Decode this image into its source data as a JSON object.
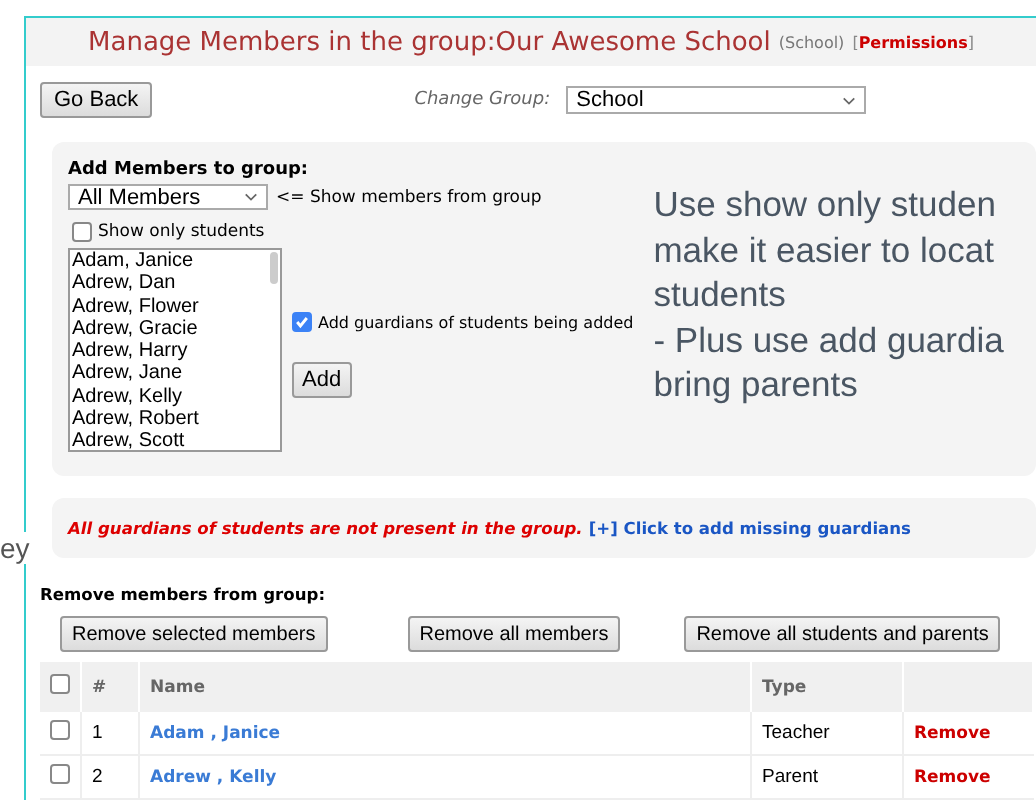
{
  "side_fragment": "ey",
  "header": {
    "title": "Manage Members in the group:Our Awesome School",
    "group_type": "(School)",
    "permissions_link": "[**Permissions**]"
  },
  "toolbar": {
    "back_button": "Go Back",
    "change_group_label": "Change Group:",
    "change_group_value": "School"
  },
  "add_panel": {
    "heading": "Add Members to group:",
    "source_group": "All Members",
    "source_hint": "<= Show members from group",
    "show_only_students": {
      "label": "Show only students",
      "checked": false
    },
    "members": [
      {
        "name": "Adam, Janice",
        "selected": false
      },
      {
        "name": "Adrew, Dan",
        "selected": false
      },
      {
        "name": "Adrew, Flower",
        "selected": false
      },
      {
        "name": "Adrew, Gracie",
        "selected": false
      },
      {
        "name": "Adrew, Harry",
        "selected": false
      },
      {
        "name": "Adrew, Jane",
        "selected": false
      },
      {
        "name": "Adrew, Kelly",
        "selected": false
      },
      {
        "name": "Adrew, Robert",
        "selected": false
      },
      {
        "name": "Adrew, Scott",
        "selected": false
      }
    ],
    "add_guardians": {
      "label": "Add guardians of students being added",
      "checked": true
    },
    "add_button": "Add",
    "note_lines": [
      "Use show only studen",
      "make it easier to locat",
      "students",
      "- Plus use add guardia",
      "bring parents"
    ]
  },
  "alert": {
    "message": "All guardians of students are not present in the group.",
    "link": "[+] Click to add missing guardians"
  },
  "remove_section": {
    "heading": "Remove members from group:",
    "buttons": [
      "Remove selected members",
      "Remove all members",
      "Remove all students and parents"
    ]
  },
  "table": {
    "columns": [
      "#",
      "Name",
      "Type"
    ],
    "all_checked": false,
    "rows": [
      {
        "number": "1",
        "name": "Adam , Janice",
        "type": "Teacher",
        "action": "Remove",
        "checked": false
      },
      {
        "number": "2",
        "name": "Adrew , Kelly",
        "type": "Parent",
        "action": "Remove",
        "checked": false
      }
    ]
  }
}
